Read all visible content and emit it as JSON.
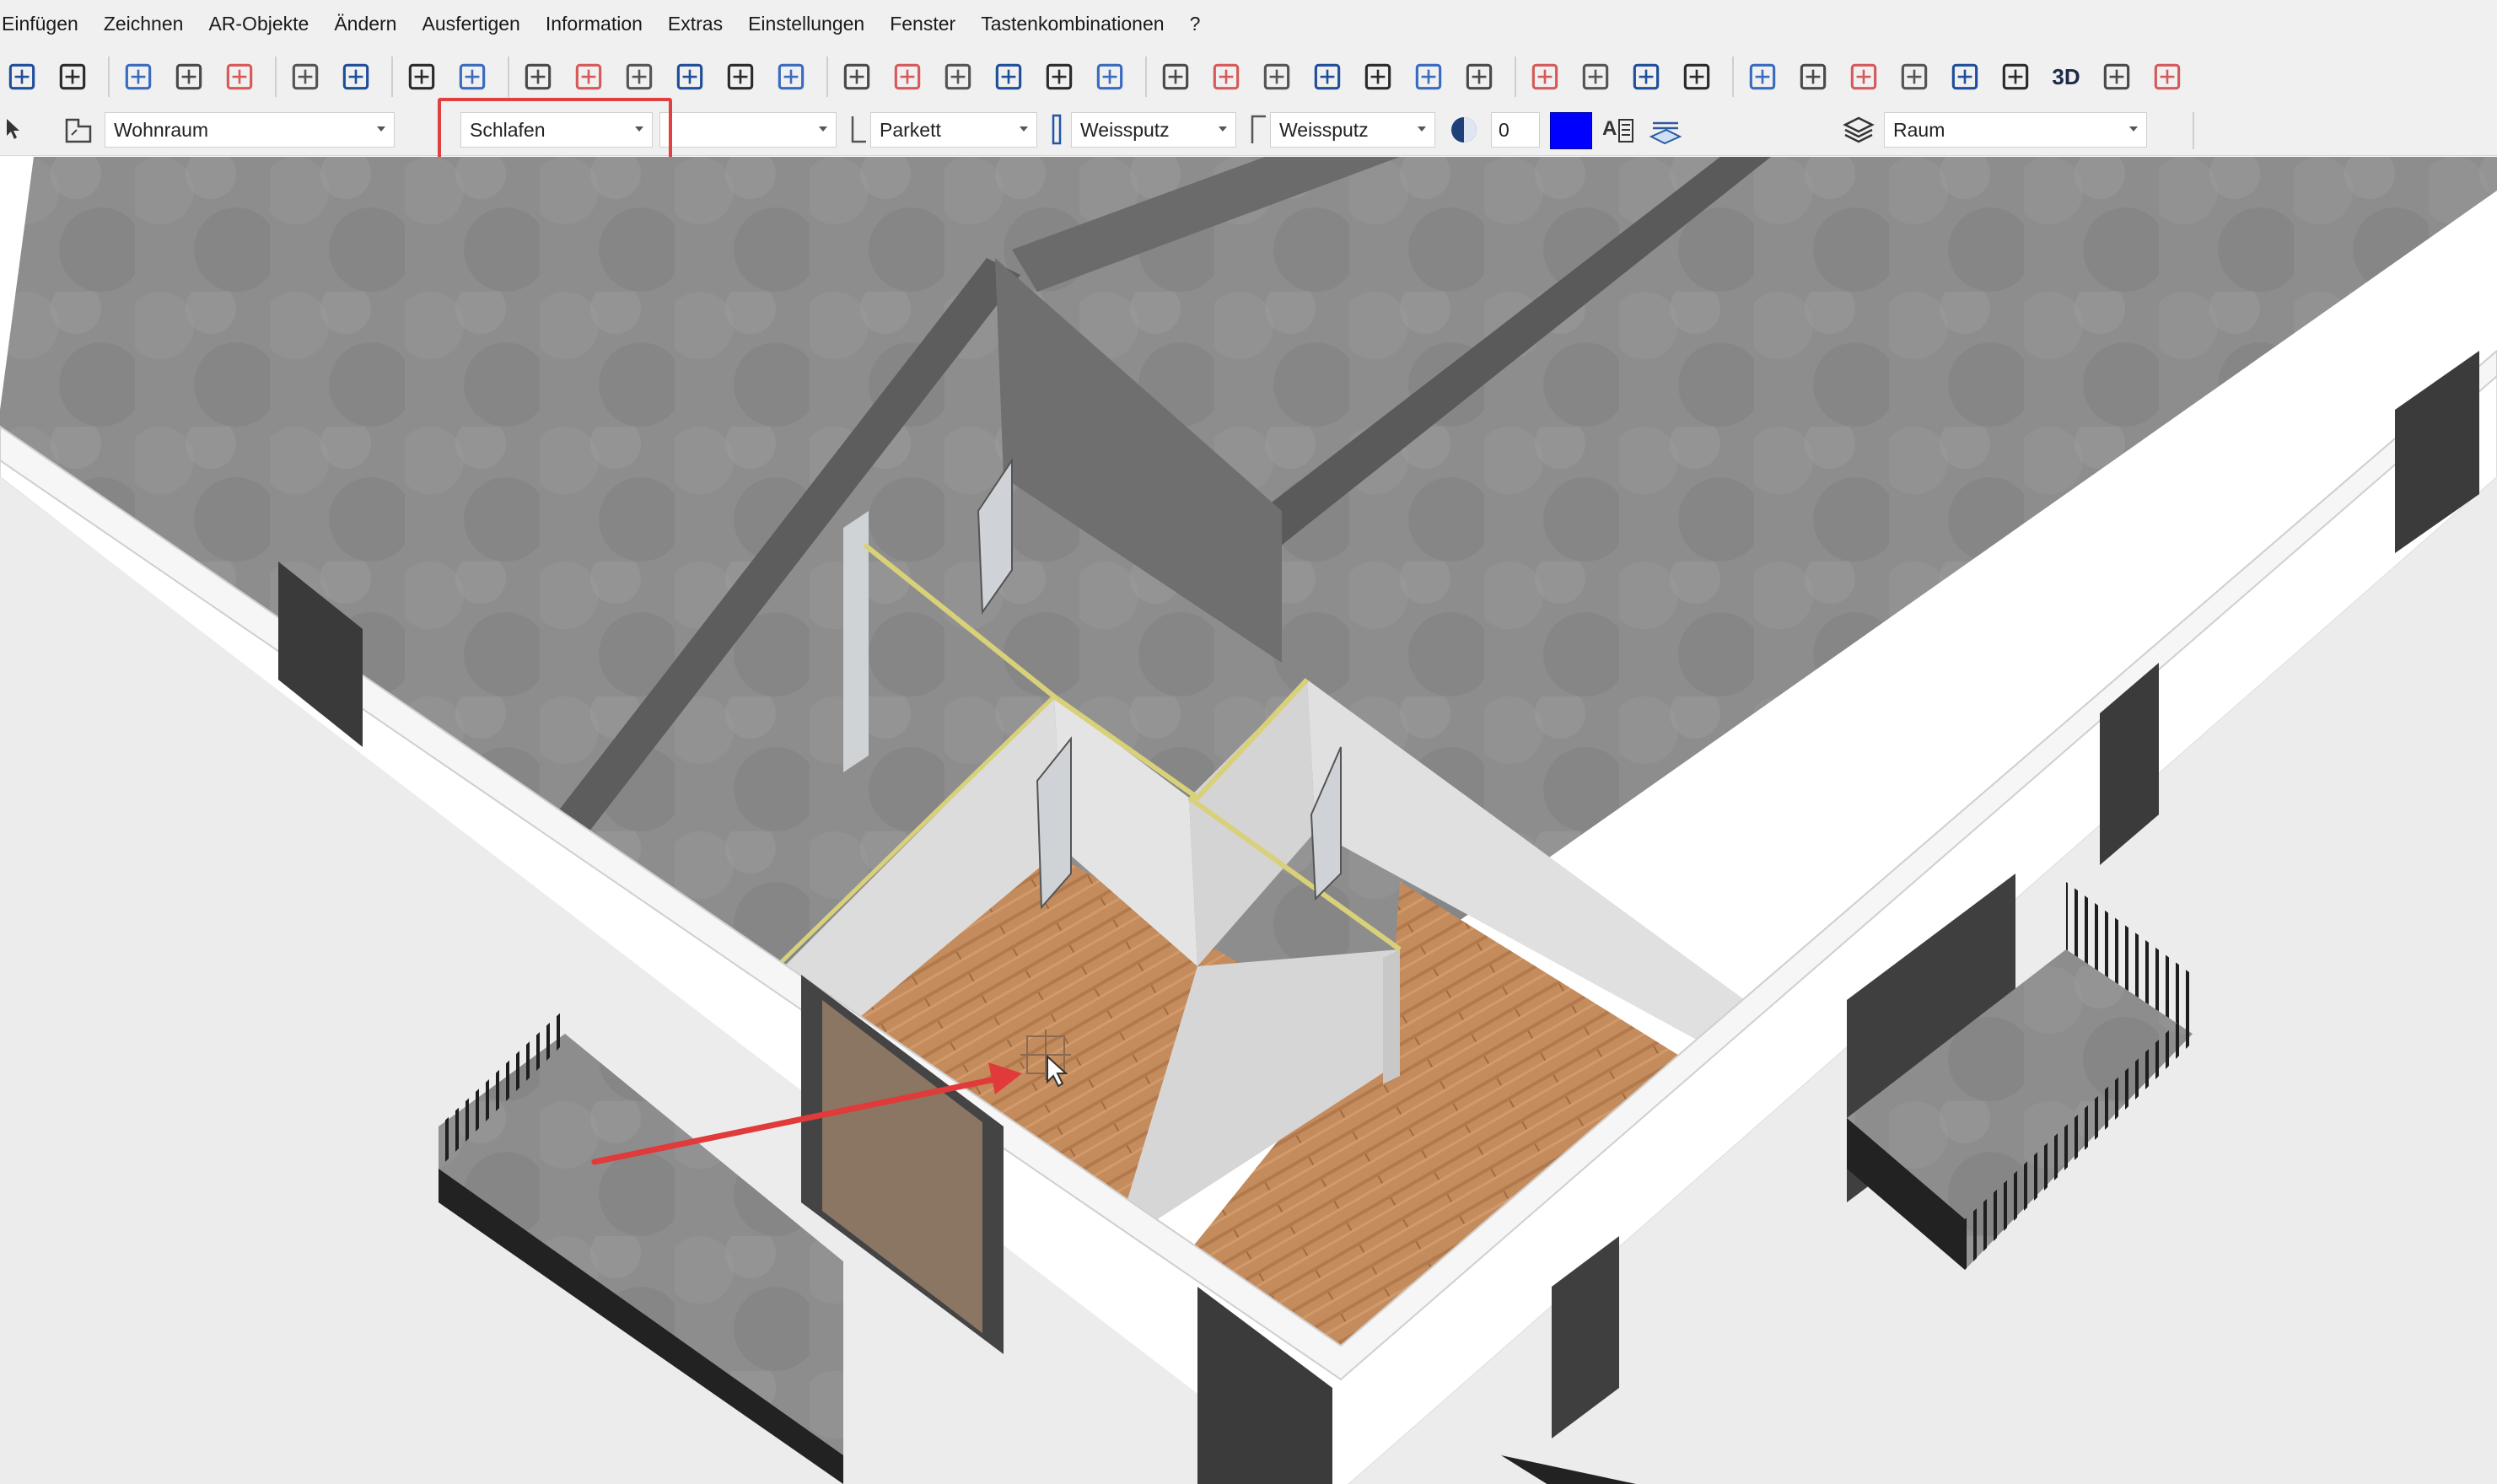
{
  "menu": {
    "items": [
      "Einfügen",
      "Zeichnen",
      "AR-Objekte",
      "Ändern",
      "Ausfertigen",
      "Information",
      "Extras",
      "Einstellungen",
      "Fenster",
      "Tastenkombinationen",
      "?"
    ]
  },
  "toolbar": {
    "icons": [
      "history-icon",
      "save-icon",
      "cut-icon",
      "copy-icon",
      "paste-icon",
      "undo-icon",
      "redo-icon",
      "add-icon",
      "remove-icon",
      "copy-objects-icon",
      "duplicate-icon",
      "rotate-icon",
      "mirror-icon",
      "scale-icon",
      "convert-icon",
      "split-icon",
      "line-icon",
      "cross-icon",
      "parallel-icon",
      "eraser-icon",
      "edit-icon",
      "box1-icon",
      "box2-icon",
      "box3-icon",
      "box4-icon",
      "box5-icon",
      "box6-icon",
      "pyramid-icon",
      "move-icon",
      "stretch-icon",
      "camera-move-icon",
      "translate-icon",
      "layer-icon",
      "elevate-icon",
      "brush-icon",
      "house-icon",
      "column-icon",
      "arc-icon",
      "3d-icon",
      "light-icon",
      "camera-icon"
    ],
    "label_3d": "3D"
  },
  "propbar": {
    "room_function": "Wohnraum",
    "room_name": "Schlafen",
    "empty_combo": "",
    "floor_material": "Parkett",
    "wall_material": "Weissputz",
    "ceiling_material": "Weissputz",
    "number_value": "0",
    "color_hex": "#0000ff",
    "layer": "Raum"
  },
  "colors": {
    "highlight_box": "#e04040",
    "arrow": "#e03a3a",
    "floor_wood": "#c08a5c",
    "concrete": "#8a8a8a"
  }
}
